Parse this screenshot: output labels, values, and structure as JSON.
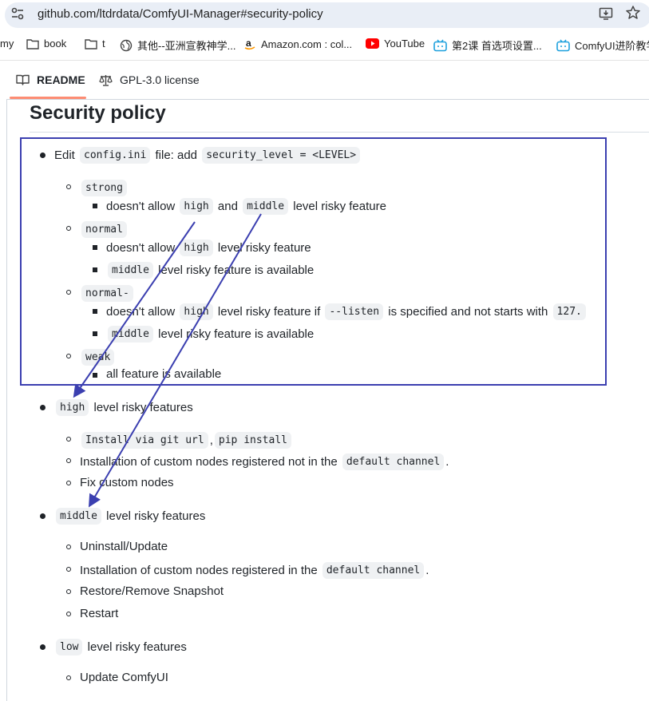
{
  "address_bar": {
    "url": "github.com/ltdrdata/ComfyUI-Manager#security-policy"
  },
  "bookmarks": [
    {
      "label": "my"
    },
    {
      "label": "book"
    },
    {
      "label": "t"
    },
    {
      "label": "其他--亚洲宣教神学..."
    },
    {
      "label": "Amazon.com : col..."
    },
    {
      "label": "YouTube"
    },
    {
      "label": "第2课 首选项设置..."
    },
    {
      "label": "ComfyUI进阶教学"
    }
  ],
  "tabs": [
    {
      "label": "README"
    },
    {
      "label": "GPL-3.0 license"
    }
  ],
  "content": {
    "heading": "Security policy",
    "edit": {
      "pre": "Edit",
      "code1": "config.ini",
      "mid": "file: add",
      "code2": "security_level = <LEVEL>"
    },
    "strong": {
      "code": "strong",
      "d1": {
        "pre": "doesn't allow",
        "c1": "high",
        "mid": "and",
        "c2": "middle",
        "post": "level risky feature"
      }
    },
    "normal": {
      "code": "normal",
      "d1": {
        "pre": "doesn't allow",
        "c1": "high",
        "post": "level risky feature"
      },
      "d2": {
        "c1": "middle",
        "post": "level risky feature is available"
      }
    },
    "normal_minus": {
      "code": "normal-",
      "d1": {
        "pre": "doesn't allow",
        "c1": "high",
        "mid": "level risky feature if",
        "c2": "--listen",
        "mid2": "is specified and not starts with",
        "c3": "127."
      },
      "d2": {
        "c1": "middle",
        "post": "level risky feature is available"
      }
    },
    "weak": {
      "code": "weak",
      "d1": "all feature is available"
    },
    "high_features": {
      "code": "high",
      "post": "level risky features",
      "items": [
        {
          "c1": "Install via git url",
          "sep": ",",
          "c2": "pip install"
        },
        {
          "pre": "Installation of custom nodes registered not in the",
          "c1": "default channel",
          "post": "."
        },
        {
          "text": "Fix custom nodes"
        }
      ]
    },
    "middle_features": {
      "code": "middle",
      "post": "level risky features",
      "items": [
        {
          "text": "Uninstall/Update"
        },
        {
          "pre": "Installation of custom nodes registered in the",
          "c1": "default channel",
          "post": "."
        },
        {
          "text": "Restore/Remove Snapshot"
        },
        {
          "text": "Restart"
        }
      ]
    },
    "low_features": {
      "code": "low",
      "post": "level risky features",
      "items": [
        {
          "text": "Update ComfyUI"
        }
      ]
    }
  },
  "annotation": {
    "color": "#3b3fb0"
  }
}
